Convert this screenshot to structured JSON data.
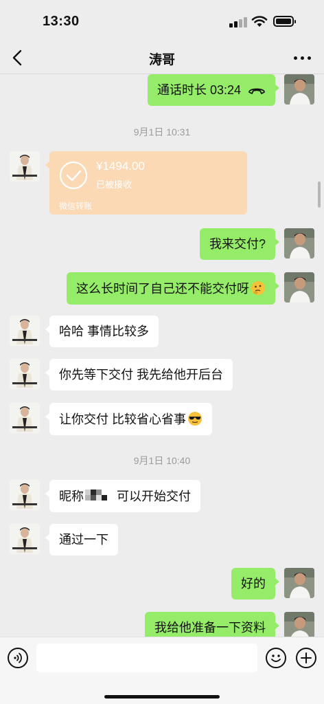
{
  "status_bar": {
    "time": "13:30"
  },
  "nav": {
    "title": "涛哥"
  },
  "messages": {
    "call": {
      "text": "通话时长 03:24"
    },
    "timestamp_1": "9月1日 10:31",
    "transfer": {
      "amount": "¥1494.00",
      "status": "已被接收",
      "footer": "微信转账"
    },
    "m1": "我来交付?",
    "m2": "这么长时间了自己还不能交付呀",
    "m3": "哈哈 事情比较多",
    "m4": "你先等下交付 我先给他开后台",
    "m5": "让你交付 比较省心省事",
    "timestamp_2": "9月1日 10:40",
    "m6_prefix": "昵称",
    "m6_suffix": "可以开始交付",
    "m7": "通过一下",
    "m8": "好的",
    "m9": "我给他准备一下资料"
  },
  "emojis": {
    "thinking": "thinking-face",
    "cool": "sunglasses-face"
  },
  "colors": {
    "self_bubble": "#95ec69",
    "friend_bubble": "#ffffff",
    "transfer_card": "#fad9b4",
    "background": "#ededed"
  },
  "input": {
    "placeholder": ""
  }
}
